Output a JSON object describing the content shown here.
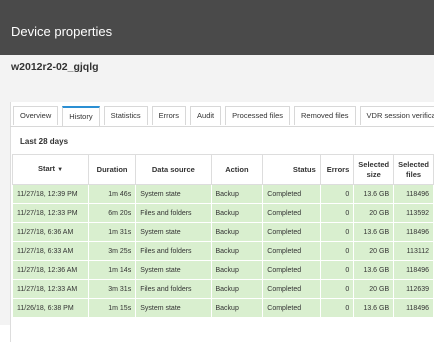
{
  "window": {
    "title": "Device properties"
  },
  "device": {
    "name": "w2012r2-02_gjqlg"
  },
  "tabs": [
    {
      "label": "Overview",
      "active": false
    },
    {
      "label": "History",
      "active": true
    },
    {
      "label": "Statistics",
      "active": false
    },
    {
      "label": "Errors",
      "active": false
    },
    {
      "label": "Audit",
      "active": false
    },
    {
      "label": "Processed files",
      "active": false
    },
    {
      "label": "Removed files",
      "active": false
    },
    {
      "label": "VDR session verification",
      "active": false
    }
  ],
  "history": {
    "range_label": "Last 28 days",
    "columns": {
      "start": "Start",
      "sort_icon": "caret-down-icon",
      "duration": "Duration",
      "source": "Data source",
      "action": "Action",
      "status": "Status",
      "errors": "Errors",
      "size": "Selected size",
      "files": "Selected files"
    },
    "rows": [
      {
        "start": "11/27/18, 12:39 PM",
        "duration": "1m 46s",
        "source": "System state",
        "action": "Backup",
        "status": "Completed",
        "errors": "0",
        "size": "13.6 GB",
        "files": "118496"
      },
      {
        "start": "11/27/18, 12:33 PM",
        "duration": "6m 20s",
        "source": "Files and folders",
        "action": "Backup",
        "status": "Completed",
        "errors": "0",
        "size": "20 GB",
        "files": "113592"
      },
      {
        "start": "11/27/18, 6:36 AM",
        "duration": "1m 31s",
        "source": "System state",
        "action": "Backup",
        "status": "Completed",
        "errors": "0",
        "size": "13.6 GB",
        "files": "118496"
      },
      {
        "start": "11/27/18, 6:33 AM",
        "duration": "3m 25s",
        "source": "Files and folders",
        "action": "Backup",
        "status": "Completed",
        "errors": "0",
        "size": "20 GB",
        "files": "113112"
      },
      {
        "start": "11/27/18, 12:36 AM",
        "duration": "1m 14s",
        "source": "System state",
        "action": "Backup",
        "status": "Completed",
        "errors": "0",
        "size": "13.6 GB",
        "files": "118496"
      },
      {
        "start": "11/27/18, 12:33 AM",
        "duration": "3m 31s",
        "source": "Files and folders",
        "action": "Backup",
        "status": "Completed",
        "errors": "0",
        "size": "20 GB",
        "files": "112639"
      },
      {
        "start": "11/26/18, 6:38 PM",
        "duration": "1m 15s",
        "source": "System state",
        "action": "Backup",
        "status": "Completed",
        "errors": "0",
        "size": "13.6 GB",
        "files": "118496"
      }
    ]
  },
  "colors": {
    "title_bar": "#4a4a4a",
    "row_completed": "#d9efcf",
    "active_tab_accent": "#2b8fd3"
  }
}
